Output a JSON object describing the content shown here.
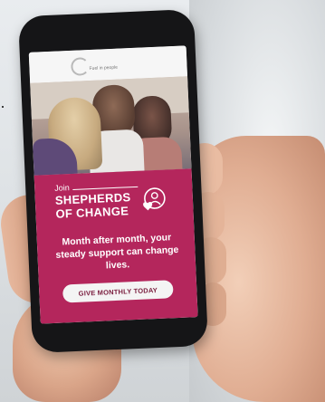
{
  "header": {
    "logo_text": "Fuel in people"
  },
  "promo": {
    "join_label": "Join",
    "brand_line1": "SHEPHERDS",
    "brand_line2": "OF CHANGE",
    "tagline": "Month after month, your steady support can change lives.",
    "cta_label": "GIVE MONTHLY TODAY"
  },
  "colors": {
    "promo_bg": "#b4265c",
    "button_bg": "#f4f4f4",
    "button_text": "#7a1d3e"
  },
  "icons": [
    "logo-icon",
    "heart-person-icon"
  ]
}
